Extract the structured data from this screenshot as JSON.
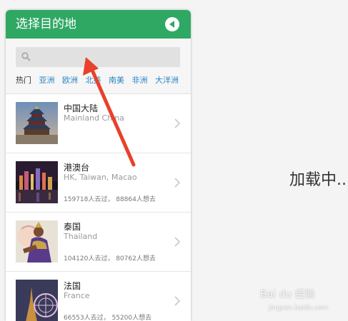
{
  "panel": {
    "title": "选择目的地",
    "back_icon": "back-arrow-icon",
    "search": {
      "placeholder": "",
      "value": "",
      "icon": "search-icon"
    },
    "tabs": [
      {
        "label": "热门",
        "active": true
      },
      {
        "label": "亚洲",
        "active": false
      },
      {
        "label": "欧洲",
        "active": false
      },
      {
        "label": "北美",
        "active": false
      },
      {
        "label": "南美",
        "active": false
      },
      {
        "label": "非洲",
        "active": false
      },
      {
        "label": "大洋洲",
        "active": false
      }
    ],
    "destinations": [
      {
        "name_cn": "中国大陆",
        "name_en": "Mainland China",
        "stats": ""
      },
      {
        "name_cn": "港澳台",
        "name_en": "HK, Taiwan, Macao",
        "stats": "159718人去过， 88864人想去"
      },
      {
        "name_cn": "泰国",
        "name_en": "Thailand",
        "stats": "104120人去过， 80762人想去"
      },
      {
        "name_cn": "法国",
        "name_en": "France",
        "stats": "66553人去过， 55200人想去"
      }
    ]
  },
  "loading_text": "加载中..",
  "watermark": {
    "brand": "Bai du 经验",
    "url": "jingyan.baidu.com"
  },
  "colors": {
    "header": "#2fa864",
    "tab_link": "#2a84c5",
    "annotation_arrow": "#e8412c"
  }
}
